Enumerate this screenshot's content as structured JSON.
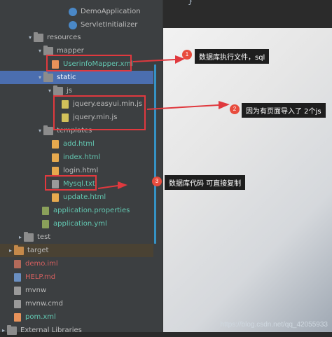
{
  "tree": {
    "items": [
      {
        "label": "DemoApplication",
        "color": "c-blue"
      },
      {
        "label": "ServletInitializer",
        "color": "c-blue"
      },
      {
        "label": "resources"
      },
      {
        "label": "mapper"
      },
      {
        "label": "UserinfoMapper.xml",
        "color": "c-teal"
      },
      {
        "label": "static"
      },
      {
        "label": "js"
      },
      {
        "label": "jquery.easyui.min.js"
      },
      {
        "label": "jquery.min.js"
      },
      {
        "label": "templates"
      },
      {
        "label": "add.html",
        "color": "c-teal"
      },
      {
        "label": "index.html",
        "color": "c-teal"
      },
      {
        "label": "login.html",
        "color": "c-teal"
      },
      {
        "label": "Mysql.txt",
        "color": "c-teal"
      },
      {
        "label": "update.html",
        "color": "c-teal"
      },
      {
        "label": "application.properties",
        "color": "c-teal"
      },
      {
        "label": "application.yml",
        "color": "c-teal"
      },
      {
        "label": "test"
      },
      {
        "label": "target"
      },
      {
        "label": "demo.iml",
        "color": "c-red"
      },
      {
        "label": "HELP.md",
        "color": "c-red"
      },
      {
        "label": "mvnw"
      },
      {
        "label": "mvnw.cmd"
      },
      {
        "label": "pom.xml",
        "color": "c-teal"
      },
      {
        "label": "External Libraries"
      }
    ]
  },
  "editor": {
    "brace": "}"
  },
  "annotations": [
    {
      "num": "1",
      "text": "数据库执行文件，sql"
    },
    {
      "num": "2",
      "text": "因为有页面导入了 2个js"
    },
    {
      "num": "3",
      "text": "数据库代码 可直接复制"
    }
  ],
  "watermark": "https://blog.csdn.net/qq_42055933",
  "colors": {
    "accent": "#e0393e",
    "selection": "#0d293e"
  }
}
